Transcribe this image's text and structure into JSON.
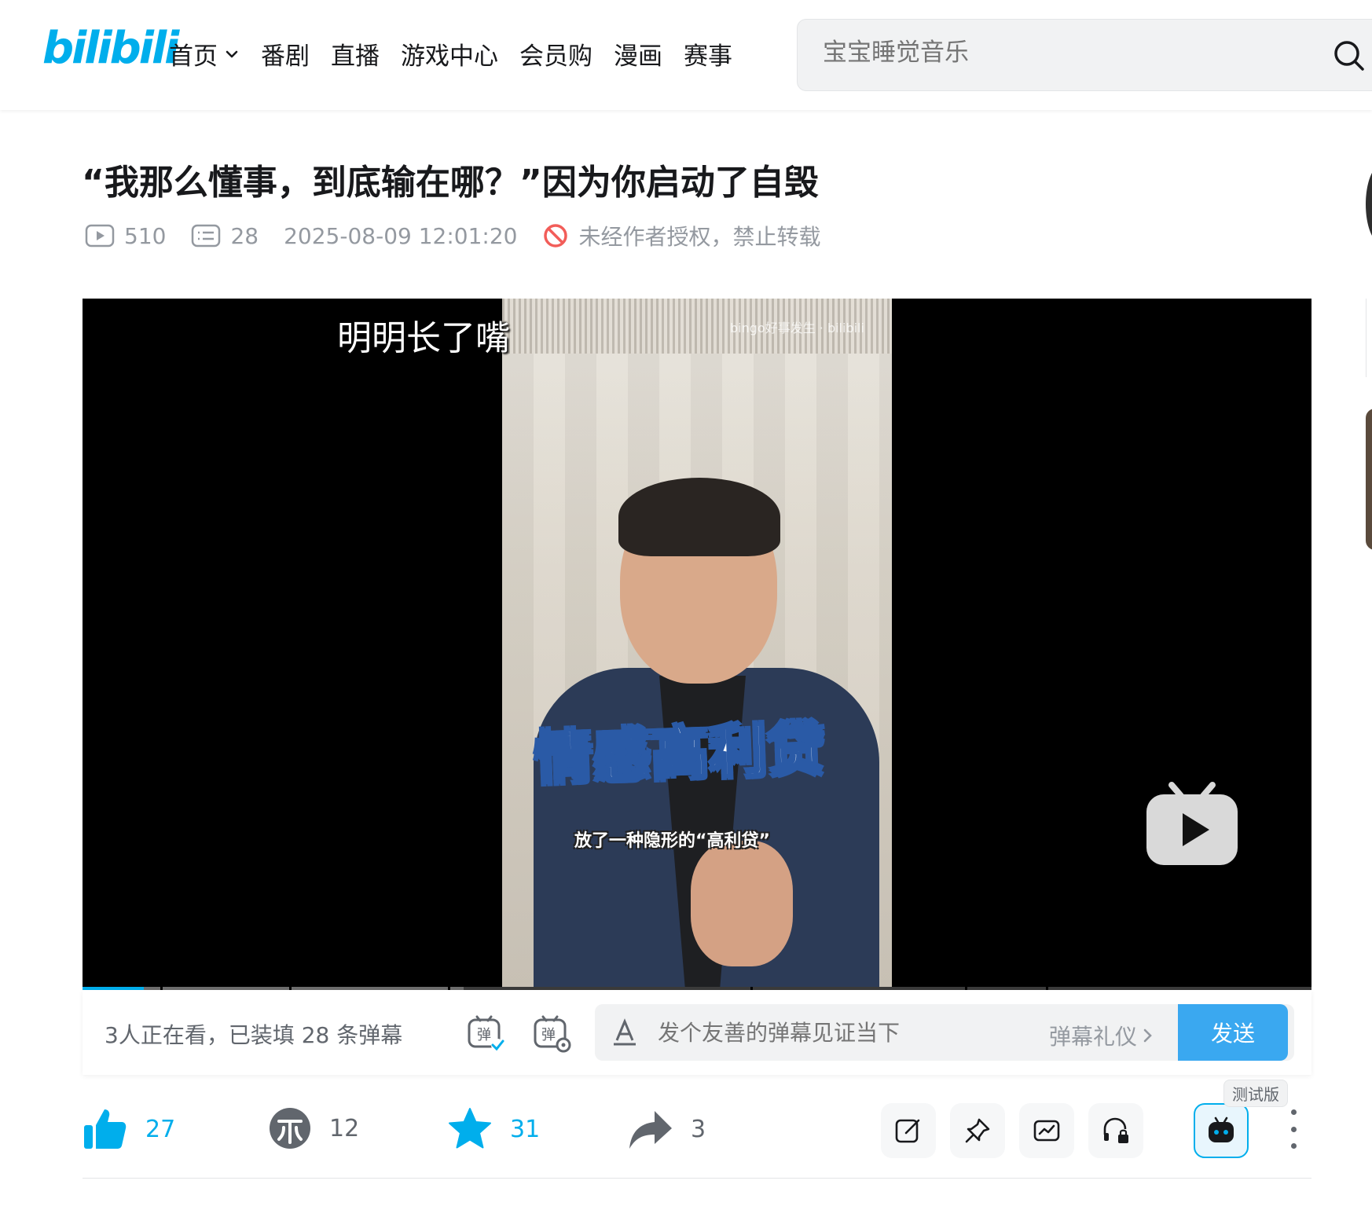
{
  "header": {
    "logo": "bilibili",
    "nav": [
      {
        "label": "首页",
        "has_dropdown": true
      },
      {
        "label": "番剧"
      },
      {
        "label": "直播"
      },
      {
        "label": "游戏中心"
      },
      {
        "label": "会员购"
      },
      {
        "label": "漫画"
      },
      {
        "label": "赛事"
      }
    ],
    "search": {
      "placeholder": "宝宝睡觉音乐",
      "icon": "search-icon"
    }
  },
  "video": {
    "title": "“我那么懂事，到底输在哪？”因为你启动了自毁",
    "views": "510",
    "danmaku_count": "28",
    "publish_time": "2025-08-09 12:01:20",
    "copyright": "未经作者授权，禁止转载"
  },
  "player": {
    "danmaku_text": "明明长了嘴",
    "watermark": "bingo好事发生 · bilibili",
    "overlay_title": "情感高利贷",
    "overlay_subtitle": "放了一种隐形的“高利贷”",
    "progress_played_fraction": 0.05,
    "progress_buffered_fraction": 0.31,
    "play_icon": "tv-play-icon"
  },
  "sendbar": {
    "viewers_text": "3人正在看，已装填 28 条弹幕",
    "input_placeholder": "发个友善的弹幕见证当下",
    "etiquette_label": "弹幕礼仪",
    "send_label": "发送"
  },
  "toolbar": {
    "like_count": "27",
    "coin_count": "12",
    "favorite_count": "31",
    "share_count": "3",
    "beta_label": "测试版"
  },
  "colors": {
    "brand_blue": "#00aeec",
    "send_button": "#3aa8f0",
    "text_secondary": "#9499a0",
    "copyright_red": "#f25d59"
  }
}
